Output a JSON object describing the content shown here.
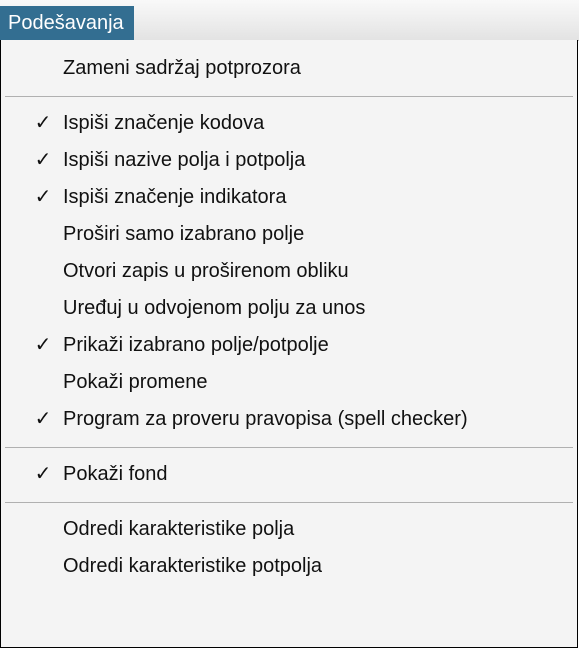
{
  "menu": {
    "title": "Podešavanja"
  },
  "items": [
    {
      "label": "Zameni sadržaj potprozora",
      "checked": false
    },
    {
      "label": "Ispiši značenje kodova",
      "checked": true
    },
    {
      "label": "Ispiši nazive polja i potpolja",
      "checked": true
    },
    {
      "label": "Ispiši značenje indikatora",
      "checked": true
    },
    {
      "label": "Proširi samo izabrano polje",
      "checked": false
    },
    {
      "label": "Otvori zapis u proširenom obliku",
      "checked": false
    },
    {
      "label": "Uređuj u odvojenom polju za unos",
      "checked": false
    },
    {
      "label": "Prikaži izabrano polje/potpolje",
      "checked": true
    },
    {
      "label": "Pokaži promene",
      "checked": false
    },
    {
      "label": "Program za proveru pravopisa (spell checker)",
      "checked": true
    },
    {
      "label": "Pokaži fond",
      "checked": true
    },
    {
      "label": "Odredi karakteristike polja",
      "checked": false
    },
    {
      "label": "Odredi karakteristike potpolja",
      "checked": false
    }
  ],
  "check_glyph": "✓"
}
